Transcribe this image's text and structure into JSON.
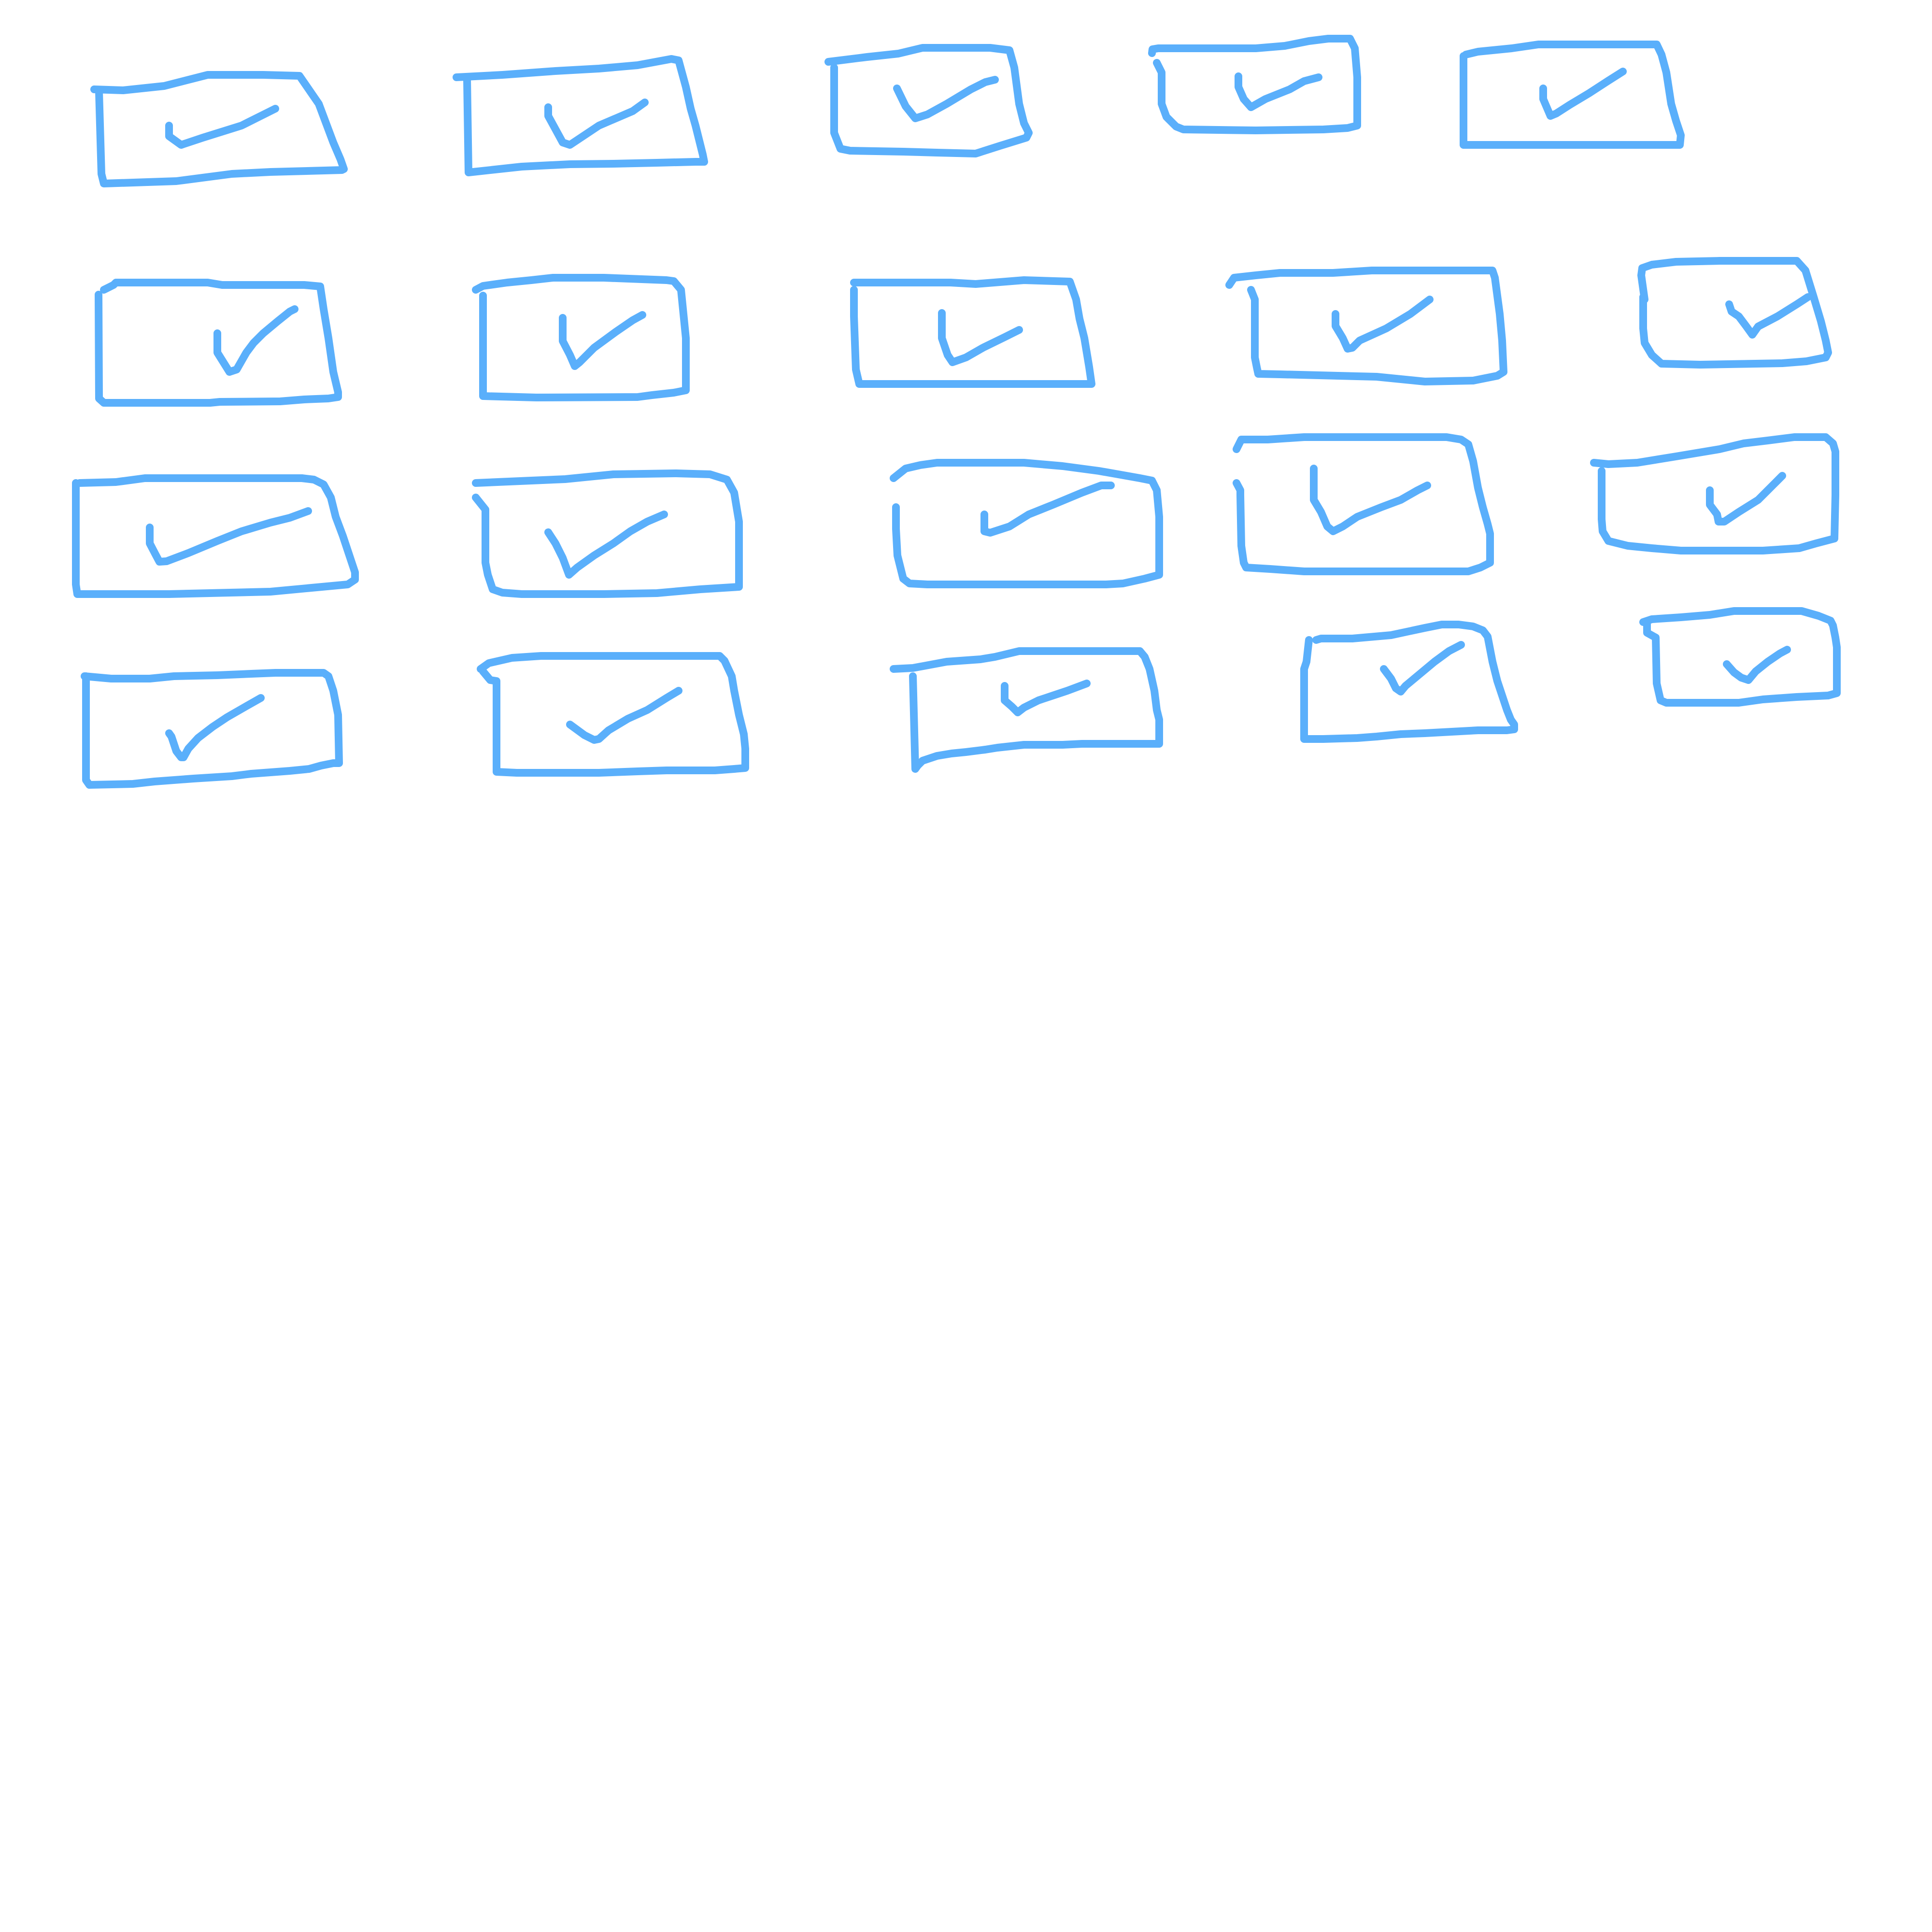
{
  "sketch": {
    "stroke_color": "#5aaffb",
    "background_color": "#ffffff",
    "rows": 4,
    "columns": 5,
    "items": [
      {
        "shape": "checked-box",
        "checked": true
      },
      {
        "shape": "checked-box",
        "checked": true
      },
      {
        "shape": "checked-box",
        "checked": true
      },
      {
        "shape": "checked-box",
        "checked": true
      },
      {
        "shape": "checked-box",
        "checked": true
      },
      {
        "shape": "checked-box",
        "checked": true
      },
      {
        "shape": "checked-box",
        "checked": true
      },
      {
        "shape": "checked-box",
        "checked": true
      },
      {
        "shape": "checked-box",
        "checked": true
      },
      {
        "shape": "checked-box",
        "checked": true
      },
      {
        "shape": "checked-box",
        "checked": true
      },
      {
        "shape": "checked-box",
        "checked": true
      },
      {
        "shape": "checked-box",
        "checked": true
      },
      {
        "shape": "checked-box",
        "checked": true
      },
      {
        "shape": "checked-box",
        "checked": true
      },
      {
        "shape": "checked-box",
        "checked": true
      },
      {
        "shape": "checked-box",
        "checked": true
      },
      {
        "shape": "checked-box",
        "checked": true
      },
      {
        "shape": "checked-box",
        "checked": true
      },
      {
        "shape": "checked-box",
        "checked": true
      }
    ]
  }
}
